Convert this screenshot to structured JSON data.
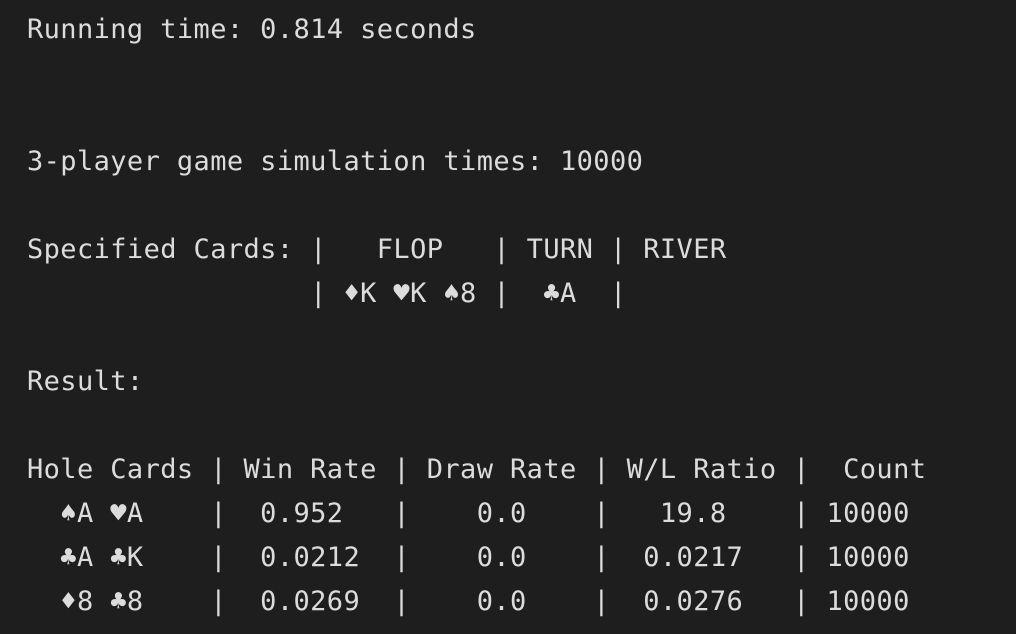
{
  "terminal": {
    "running_time": "Running time: 0.814 seconds",
    "simulation_times": "3-player game simulation times: 10000",
    "specified_cards": {
      "header_line": "Specified Cards: |   FLOP   | TURN | RIVER",
      "cards_line": "                 | ♦K ♥K ♠8 |  ♣A  |"
    },
    "result_label": "Result:",
    "results_table": {
      "header_line": "Hole Cards | Win Rate | Draw Rate | W/L Ratio |  Count",
      "rows": [
        {
          "line": "  ♠A ♥A    |  0.952   |    0.0    |   19.8    | 10000"
        },
        {
          "line": "  ♣A ♣K    |  0.0212  |    0.0    |  0.0217   | 10000"
        },
        {
          "line": "  ♦8 ♣8    |  0.0269  |    0.0    |  0.0276   | 10000"
        }
      ]
    }
  },
  "colors": {
    "background": "#1e1e1e",
    "text": "#dcdcdc"
  }
}
